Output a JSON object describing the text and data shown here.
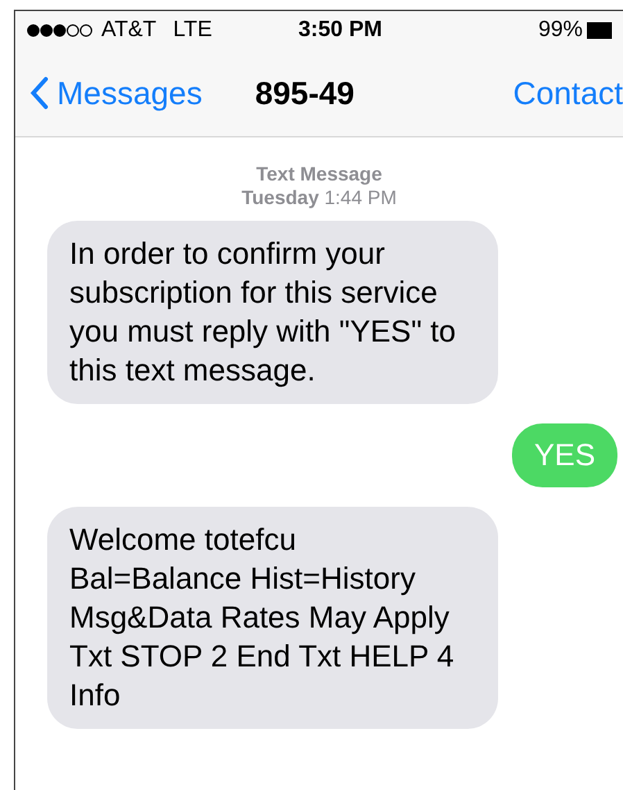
{
  "status_bar": {
    "carrier": "AT&T",
    "network": "LTE",
    "time": "3:50 PM",
    "battery": "99%"
  },
  "nav": {
    "back": "Messages",
    "title": "895-49",
    "action": "Contact"
  },
  "timestamp": {
    "label": "Text Message",
    "time": "**Tuesday** 1:44 PM"
  },
  "messages": [
    {
      "kind": "incoming",
      "text": "In order to confirm your subscription for this service you must reply with \"YES\" to this text message."
    },
    {
      "kind": "outgoing",
      "text": "YES"
    },
    {
      "kind": "incoming",
      "text": "Welcome totefcu Bal=Balance Hist=History Msg&Data Rates May Apply Txt STOP 2 End Txt HELP 4 Info"
    }
  ]
}
